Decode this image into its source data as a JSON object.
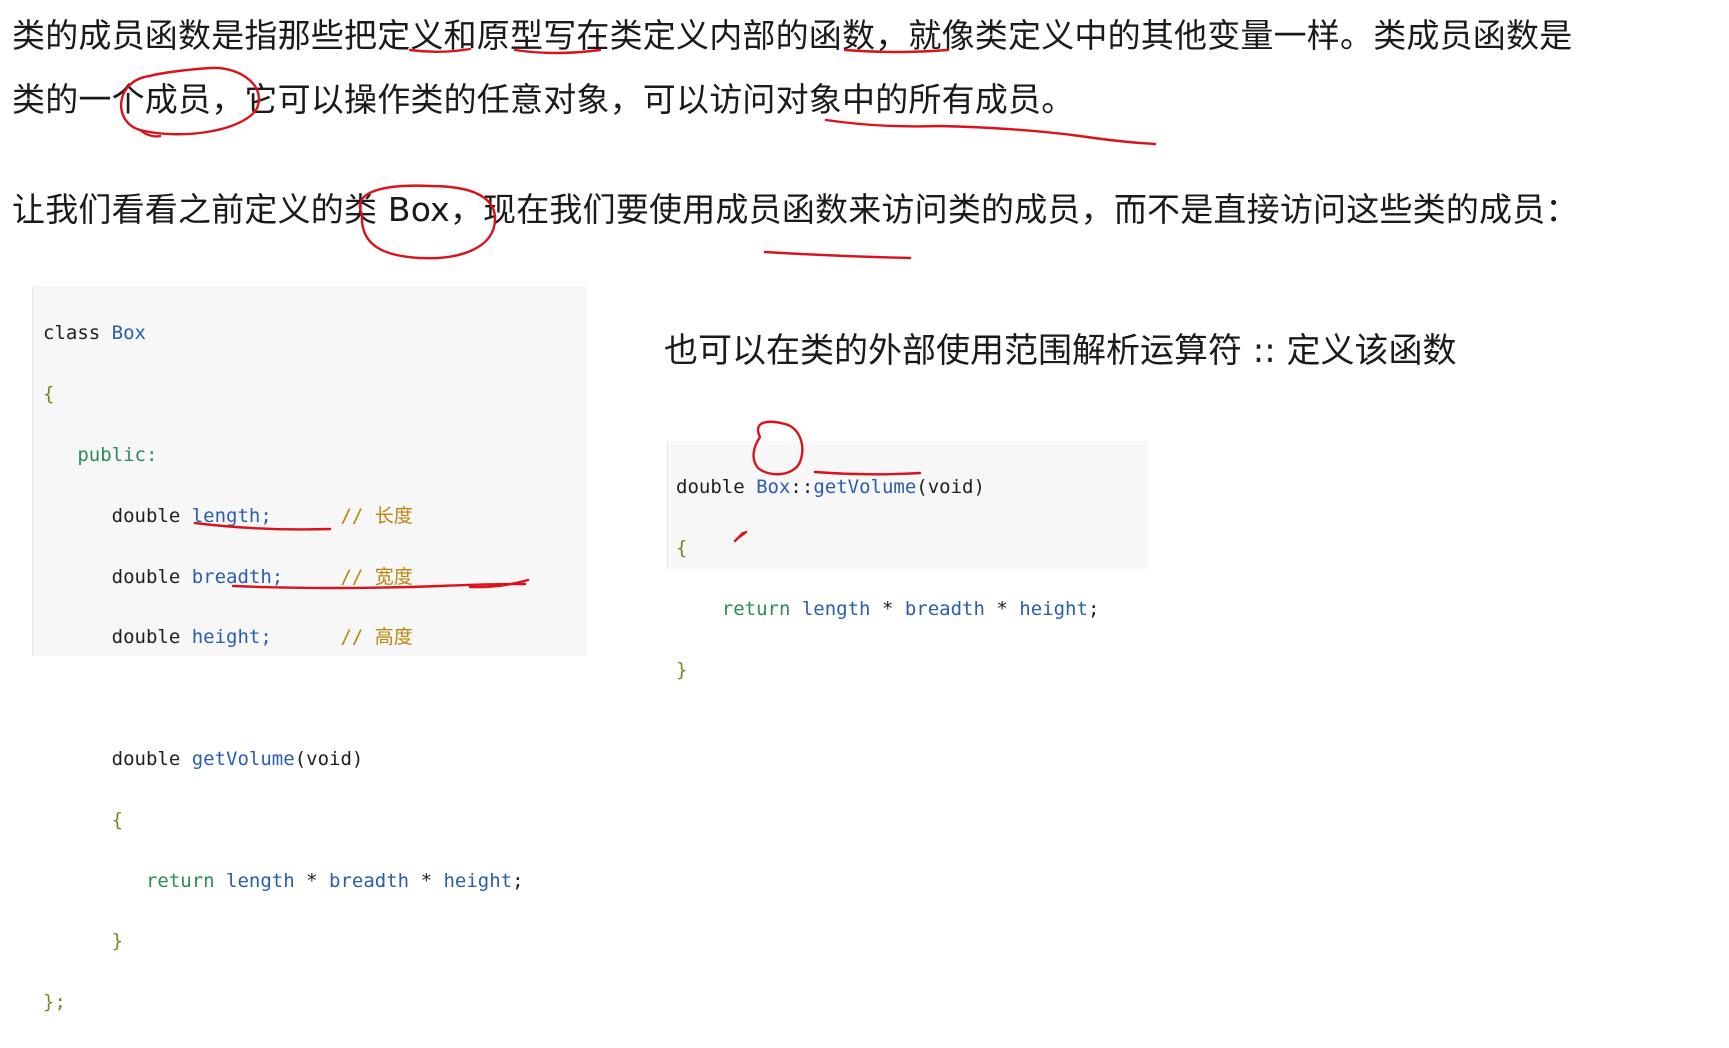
{
  "paragraphs": {
    "p1": "类的成员函数是指那些把定义和原型写在类定义内部的函数，就像类定义中的其他变量一样。类成员函数是类的一个成员，它可以操作类的任意对象，可以访问对象中的所有成员。",
    "p1_line1": "类的成员函数是指那些把定义和原型写在类定义内部的函数，就像类定义中的其他变量一样。类成员函数是",
    "p1_line2": "类的一个成员，它可以操作类的任意对象，可以访问对象中的所有成员。",
    "p2": "让我们看看之前定义的类 Box，现在我们要使用成员函数来访问类的成员，而不是直接访问这些类的成员："
  },
  "code_class": {
    "lines": [
      {
        "kw": "class",
        "name": "Box"
      },
      {
        "brace": "{"
      },
      {
        "kw": "public:"
      },
      {
        "type": "double",
        "name": "length;",
        "comment": "// 长度"
      },
      {
        "type": "double",
        "name": "breadth;",
        "comment": "// 宽度"
      },
      {
        "type": "double",
        "name": "height;",
        "comment": "// 高度"
      },
      {},
      {
        "type": "double",
        "name": "getVolume",
        "args": "(void)"
      },
      {
        "brace": "{"
      },
      {
        "kw": "return",
        "expr": "length * breadth * height;"
      },
      {
        "brace": "}"
      },
      {
        "brace": "};"
      }
    ]
  },
  "caption": "也可以在类的外部使用范围解析运算符 :: 定义该函数",
  "code_func": {
    "lines": [
      {
        "type": "double",
        "scope": "Box",
        "sep": "::",
        "name": "getVolume",
        "args": "(void)"
      },
      {
        "brace": "{"
      },
      {
        "kw": "return",
        "expr": "length * breadth * height;"
      },
      {
        "brace": "}"
      }
    ]
  },
  "annotation_color": "#d9121b",
  "tokens": {
    "class": "class",
    "Box": "Box",
    "public": "public:",
    "double": "double",
    "length": "length;",
    "breadth": "breadth;",
    "height": "height;",
    "cmt_length": "// 长度",
    "cmt_breadth": "// 宽度",
    "cmt_height": "// 高度",
    "getVolume": "getVolume",
    "void_args": "(void)",
    "open_brace": "{",
    "close_brace": "}",
    "close_class": "};",
    "return": "return",
    "expr_length": "length",
    "star": "*",
    "expr_breadth": "breadth",
    "expr_height": "height",
    "semicolon": ";",
    "scope_sep": "::"
  }
}
